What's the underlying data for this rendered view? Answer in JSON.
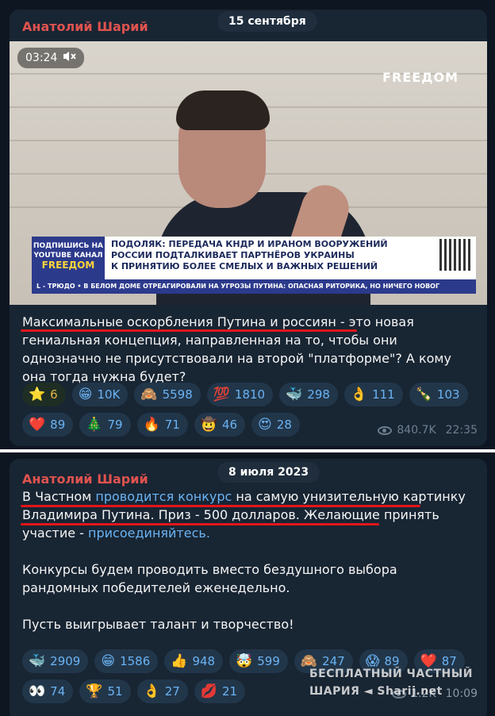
{
  "messages": [
    {
      "author": "Анатолий Шарий",
      "date": "15 сентября",
      "video": {
        "duration": "03:24",
        "logo": "FREEДOM",
        "lower_third": {
          "brand_line1": "ПОДПИШИСЬ НА",
          "brand_line2": "YOUTUBE КАНАЛ",
          "brand_name": "FREEДOM",
          "headline_line1": "ПОДОЛЯК: ПЕРЕДАЧА КНДР И ИРАНОМ ВООРУЖЕНИЙ",
          "headline_line2": "РОССИИ ПОДТАЛКИВАЕТ ПАРТНЁРОВ УКРАИНЫ",
          "headline_line3": "К ПРИНЯТИЮ БОЛЕЕ СМЕЛЫХ И ВАЖНЫХ РЕШЕНИЙ",
          "ticker": "L - ТРЮДО  •  В БЕЛОМ ДОМЕ ОТРЕАГИРОВАЛИ НА УГРОЗЫ ПУТИНА: ОПАСНАЯ РИТОРИКА, НО НИЧЕГО НОВОГ"
        }
      },
      "text_part1": "Максимальные оскорбления Путина и россиян",
      "text_part2": " - это новая гениальная концепция, направленная на то, чтобы они однозначно не присутствовали на второй \"платформе\"? А кому она тогда нужна будет?",
      "reactions": [
        {
          "emoji": "⭐",
          "count": "6",
          "icon": "star-icon"
        },
        {
          "emoji": "😁",
          "count": "10K",
          "icon": "grin-icon"
        },
        {
          "emoji": "🙈",
          "count": "5598",
          "icon": "see-no-evil-monkey-icon"
        },
        {
          "emoji": "💯",
          "count": "1810",
          "icon": "hundred-icon"
        },
        {
          "emoji": "🐳",
          "count": "298",
          "icon": "whale-icon"
        },
        {
          "emoji": "👌",
          "count": "111",
          "icon": "ok-hand-icon"
        },
        {
          "emoji": "🍾",
          "count": "103",
          "icon": "champagne-icon"
        },
        {
          "emoji": "❤️",
          "count": "89",
          "icon": "heart-icon"
        },
        {
          "emoji": "🎄",
          "count": "79",
          "icon": "christmas-tree-icon"
        },
        {
          "emoji": "🔥",
          "count": "71",
          "icon": "fire-icon"
        },
        {
          "emoji": "🤠",
          "count": "46",
          "icon": "cowboy-face-icon"
        },
        {
          "emoji": "😍",
          "count": "28",
          "icon": "heart-eyes-icon"
        }
      ],
      "views": "840.7K",
      "time": "22:35"
    },
    {
      "author": "Анатолий Шарий",
      "date": "8 июля 2023",
      "p1_a": "В Частном ",
      "p1_link": "проводится конкурс",
      "p1_b": " на самую унизительную картинку Владимира Путина. Приз - 500 долларов.",
      "p1_c": " Желающие принять участие - ",
      "p1_link2": "присоединяйтесь.",
      "p2": "Конкурсы будем проводить вместо бездушного выбора рандомных победителей еженедельно.",
      "p3": "Пусть выигрывает талант и творчество!",
      "reactions": [
        {
          "emoji": "🐳",
          "count": "2909",
          "icon": "whale-icon"
        },
        {
          "emoji": "😁",
          "count": "1586",
          "icon": "grin-icon"
        },
        {
          "emoji": "👍",
          "count": "948",
          "icon": "thumbs-up-icon"
        },
        {
          "emoji": "🤯",
          "count": "599",
          "icon": "exploding-head-icon"
        },
        {
          "emoji": "🙈",
          "count": "247",
          "icon": "see-no-evil-monkey-icon"
        },
        {
          "emoji": "😱",
          "count": "89",
          "icon": "scream-icon"
        },
        {
          "emoji": "❤️",
          "count": "87",
          "icon": "heart-icon"
        },
        {
          "emoji": "👀",
          "count": "74",
          "icon": "eyes-icon"
        },
        {
          "emoji": "🏆",
          "count": "51",
          "icon": "trophy-icon"
        },
        {
          "emoji": "👌",
          "count": "27",
          "icon": "ok-hand-icon"
        },
        {
          "emoji": "💋",
          "count": "21",
          "icon": "kiss-icon"
        }
      ],
      "views": "1.2K",
      "time": "10:09"
    }
  ],
  "watermark": {
    "line1": "БЕСПЛАТНЫЙ ЧАСТНЫЙ",
    "line2": "ШАРИЯ ◄ Sharij.net"
  },
  "colors": {
    "background": "#0e1621",
    "bubble": "#182533",
    "author": "#e0534f",
    "link": "#6ab3f3",
    "underline": "#e3151b"
  }
}
